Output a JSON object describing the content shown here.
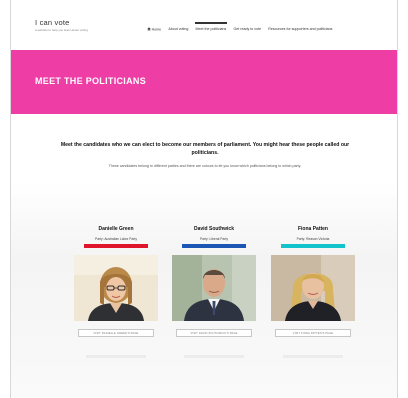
{
  "site": {
    "title": "I can vote",
    "tagline": "a website to help you learn about voting"
  },
  "nav": {
    "items": [
      {
        "label": "Home",
        "icon": "home-icon",
        "active": false
      },
      {
        "label": "About voting",
        "active": false
      },
      {
        "label": "Meet the politicians",
        "active": true
      },
      {
        "label": "Get ready to vote",
        "active": false
      },
      {
        "label": "Resources for supporters and politicians",
        "active": false
      }
    ]
  },
  "banner": {
    "title": "MEET THE POLITICIANS",
    "color": "#ee3ea6"
  },
  "intro": {
    "strong": "Meet the candidates who we can elect to become our members of parliament. You might hear these people called our politicians.",
    "small": "These candidates belong to different parties and there are colours to let you know which politicians belong to which party."
  },
  "candidates": [
    {
      "name": "Danielle Green",
      "party": "Party: Australian Labor Party",
      "party_color": "#e0142b",
      "button": "VISIT DANIELLE GREEN'S PAGE",
      "photo": "portrait-woman-glasses"
    },
    {
      "name": "David Southwick",
      "party": "Party: Liberal Party",
      "party_color": "#1b56b4",
      "button": "VISIT DAVID SOUTHWICK'S PAGE",
      "photo": "portrait-man-suit"
    },
    {
      "name": "Fiona Patten",
      "party": "Party: Reason Victoria",
      "party_color": "#13c3cc",
      "button": "VISIT FIONA PATTEN'S PAGE",
      "photo": "portrait-woman-blonde"
    }
  ]
}
